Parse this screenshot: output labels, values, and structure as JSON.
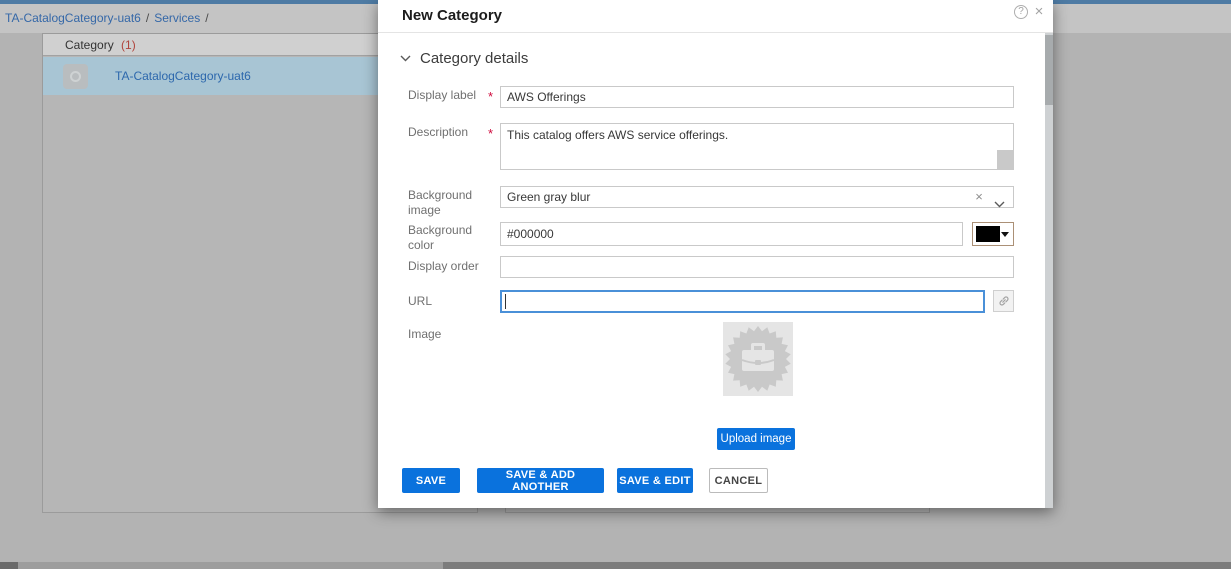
{
  "page": {
    "top_accent_color": "#4e7ba4",
    "breadcrumb": {
      "item1": "TA-CatalogCategory-uat6",
      "sep1": "/",
      "item2": "Services",
      "sep2": "/"
    },
    "category_panel": {
      "title": "Category",
      "count": "(1)",
      "selected_row_label": "TA-CatalogCategory-uat6"
    }
  },
  "modal": {
    "title": "New Category",
    "help_icon": "?",
    "close_icon": "×",
    "section_label": "Category details",
    "required_marker": "*",
    "fields": {
      "display_label": {
        "label": "Display label",
        "value": "AWS Offerings"
      },
      "description": {
        "label": "Description",
        "value": "This catalog offers AWS service offerings."
      },
      "background_image": {
        "label": "Background image",
        "value": "Green gray blur",
        "clear_icon": "×"
      },
      "background_color": {
        "label": "Background color",
        "value": "#000000",
        "swatch_color": "#000000"
      },
      "display_order": {
        "label": "Display order",
        "value": ""
      },
      "url": {
        "label": "URL",
        "value": ""
      },
      "image": {
        "label": "Image"
      }
    },
    "upload_button_label": "Upload image",
    "buttons": {
      "save": "SAVE",
      "save_add": "SAVE & ADD ANOTHER",
      "save_edit": "SAVE & EDIT",
      "cancel": "CANCEL"
    }
  },
  "colors": {
    "primary_button": "#0a72dd",
    "selected_row": "#a8c5d4",
    "focus_border": "#4a90d8"
  }
}
